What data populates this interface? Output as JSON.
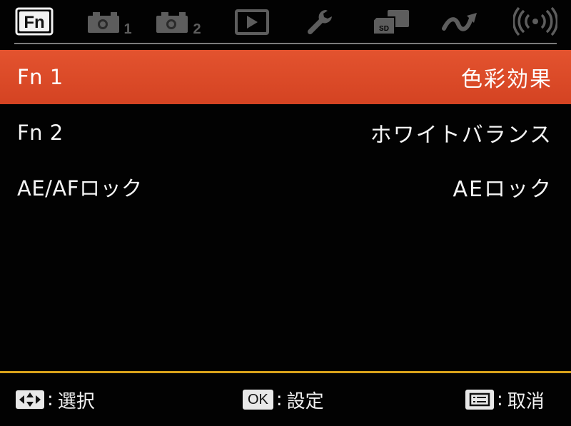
{
  "tabs": [
    {
      "name": "fn-tab",
      "label": "Fn",
      "selected": true
    },
    {
      "name": "shooting-1-tab",
      "label": "1",
      "selected": false
    },
    {
      "name": "shooting-2-tab",
      "label": "2",
      "selected": false
    },
    {
      "name": "playback-tab",
      "label": "",
      "selected": false
    },
    {
      "name": "setup-tab",
      "label": "",
      "selected": false
    },
    {
      "name": "card-tab",
      "label": "SD",
      "selected": false
    },
    {
      "name": "wifi-tab",
      "label": "",
      "selected": false
    },
    {
      "name": "wireless-tab",
      "label": "",
      "selected": false
    }
  ],
  "menu": {
    "items": [
      {
        "label": "Fn 1",
        "value": "色彩効果",
        "selected": true
      },
      {
        "label": "Fn 2",
        "value": "ホワイトバランス",
        "selected": false
      },
      {
        "label": "AE/AFロック",
        "value": "AEロック",
        "selected": false
      }
    ]
  },
  "guide": {
    "select": "選択",
    "ok_key": "OK",
    "confirm": "設定",
    "cancel": "取消",
    "colon": ":"
  },
  "colors": {
    "selected_row": "#d9492a",
    "bottom_rule": "#d9a21a",
    "background": "#020202",
    "inactive_icon": "#5d5d5d"
  }
}
